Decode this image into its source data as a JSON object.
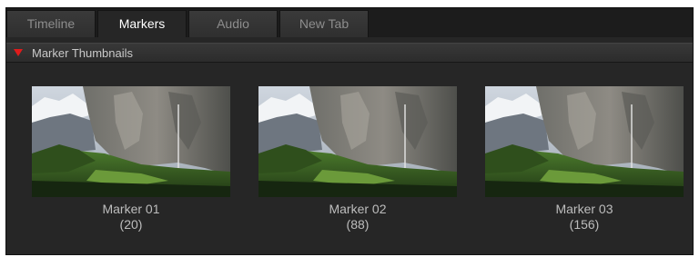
{
  "tabs": [
    {
      "label": "Timeline",
      "active": false
    },
    {
      "label": "Markers",
      "active": true
    },
    {
      "label": "Audio",
      "active": false
    },
    {
      "label": "New Tab",
      "active": false
    }
  ],
  "section": {
    "title": "Marker Thumbnails",
    "expanded": true,
    "icon": "disclosure-triangle-down-icon",
    "icon_color": "#e01b1b"
  },
  "markers": [
    {
      "name": "Marker 01",
      "frame": "(20)"
    },
    {
      "name": "Marker 02",
      "frame": "(88)"
    },
    {
      "name": "Marker 03",
      "frame": "(156)"
    }
  ],
  "colors": {
    "panel_bg": "#262626",
    "tab_bg": "#333333",
    "active_tab_text": "#ffffff",
    "inactive_tab_text": "#8d8d8d"
  }
}
